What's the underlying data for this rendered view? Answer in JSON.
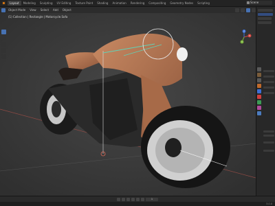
{
  "app": {
    "logo_name": "blender-logo-icon"
  },
  "top_menu": {
    "tabs": [
      "Layout",
      "Modeling",
      "Sculpting",
      "UV Editing",
      "Texture Paint",
      "Shading",
      "Animation",
      "Rendering",
      "Compositing",
      "Geometry Nodes",
      "Scripting"
    ],
    "active_index": 0,
    "scene_name": "Scene"
  },
  "viewport": {
    "header_mode": "Object Mode",
    "header_items": [
      "View",
      "Select",
      "Add",
      "Object"
    ],
    "info_text": "(1) Collection | Rectangle | Motorcycle.Sofa",
    "light_gizmo_icon": "light-target-icon",
    "axis_gizmo": {
      "x": "X",
      "y": "Y",
      "z": "Z"
    }
  },
  "timeline": {
    "frame": "1"
  },
  "status": {
    "left": "",
    "version": "3.0.0"
  },
  "colors": {
    "accent": "#4772b3",
    "body_copper": "#b5734f",
    "tire": "#1b1b1b",
    "rim": "#c6c6c6",
    "light_line": "#5fd3b8",
    "axis_x": "#d4453f",
    "axis_y": "#7ab33a",
    "axis_z": "#3d6fd6"
  }
}
